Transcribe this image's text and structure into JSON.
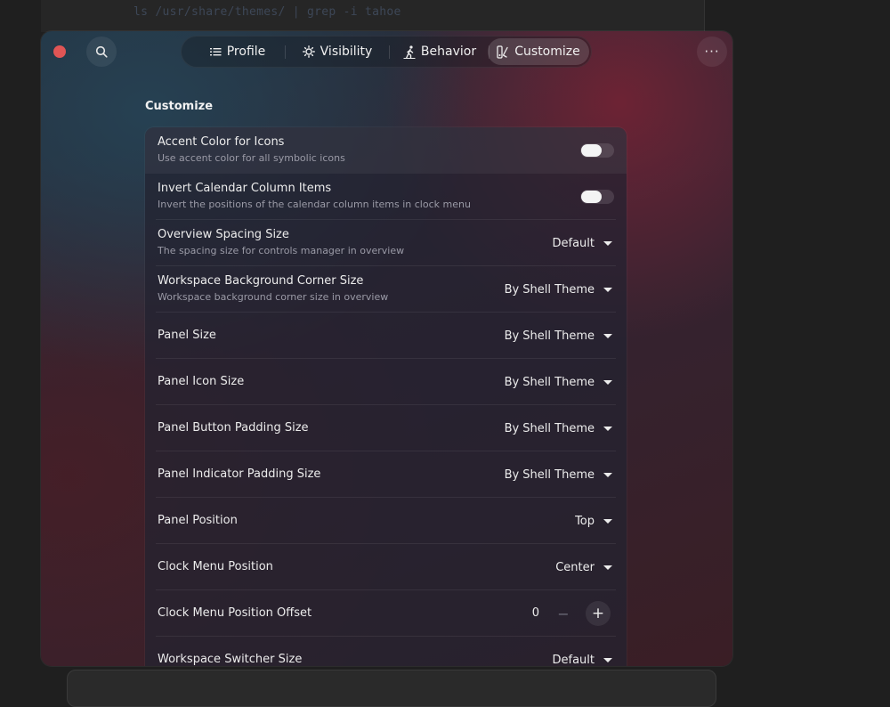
{
  "terminal": {
    "command": "ls /usr/share/themes/ | grep -i tahoe"
  },
  "header": {
    "tabs": [
      {
        "label": "Profile",
        "icon": "list-icon"
      },
      {
        "label": "Visibility",
        "icon": "sun-icon"
      },
      {
        "label": "Behavior",
        "icon": "walking-person-icon"
      },
      {
        "label": "Customize",
        "icon": "brush-icon",
        "active": true
      }
    ],
    "menu_label": "···"
  },
  "section": {
    "title": "Customize"
  },
  "rows": [
    {
      "title": "Accent Color for Icons",
      "subtitle": "Use accent color for all symbolic icons",
      "control": "switch",
      "value": false
    },
    {
      "title": "Invert Calendar Column Items",
      "subtitle": "Invert the positions of the calendar column items in clock menu",
      "control": "switch",
      "value": false
    },
    {
      "title": "Overview Spacing Size",
      "subtitle": "The spacing size for controls manager in overview",
      "control": "dropdown",
      "value": "Default"
    },
    {
      "title": "Workspace Background Corner Size",
      "subtitle": "Workspace background corner size in overview",
      "control": "dropdown",
      "value": "By Shell Theme"
    },
    {
      "title": "Panel Size",
      "control": "dropdown",
      "value": "By Shell Theme"
    },
    {
      "title": "Panel Icon Size",
      "control": "dropdown",
      "value": "By Shell Theme"
    },
    {
      "title": "Panel Button Padding Size",
      "control": "dropdown",
      "value": "By Shell Theme"
    },
    {
      "title": "Panel Indicator Padding Size",
      "control": "dropdown",
      "value": "By Shell Theme"
    },
    {
      "title": "Panel Position",
      "control": "dropdown",
      "value": "Top"
    },
    {
      "title": "Clock Menu Position",
      "control": "dropdown",
      "value": "Center"
    },
    {
      "title": "Clock Menu Position Offset",
      "control": "spin",
      "value": "0",
      "minus": "−",
      "plus": "+"
    },
    {
      "title": "Workspace Switcher Size",
      "control": "dropdown",
      "value": "Default"
    }
  ],
  "colors": {
    "close": "#e05555",
    "accent_bg": "#2b2a3a"
  }
}
